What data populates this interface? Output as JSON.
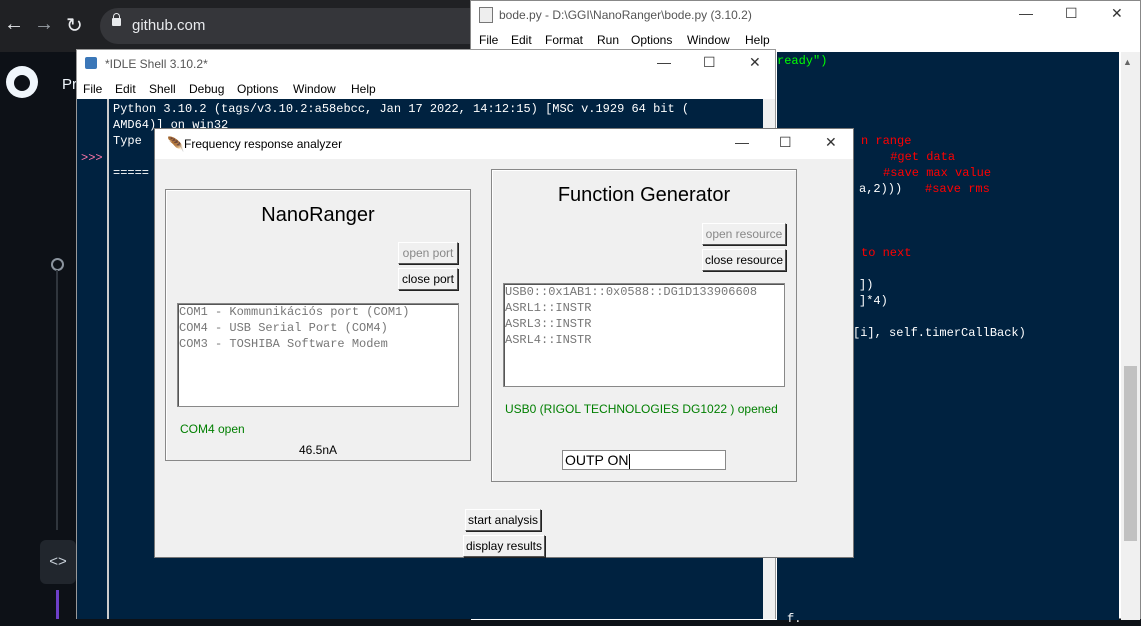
{
  "browser": {
    "url": "github.com",
    "partial_nav_text": "Pr",
    "back_glyph": "←",
    "forward_glyph": "→",
    "reload_glyph": "↻",
    "code_glyph": "<>"
  },
  "editor": {
    "title": "bode.py - D:\\GGI\\NanoRanger\\bode.py (3.10.2)",
    "menu": [
      "File",
      "Edit",
      "Format",
      "Run",
      "Options",
      "Window",
      "Help"
    ],
    "code_lines": [
      {
        "text": "ready\")",
        "color": "#00ff00"
      },
      {
        "text": "n range",
        "color": "#ff0000"
      },
      {
        "text": "      #get data",
        "color": "#ff0000"
      },
      {
        "text": "     #save max value",
        "color": "#ff0000"
      },
      {
        "text": "a,2)))",
        "color": "#ffffff"
      },
      {
        "text": "#save rms",
        "color": "#ff0000"
      },
      {
        "text": "to next",
        "color": "#ff0000"
      },
      {
        "text": "])",
        "color": "#ffffff"
      },
      {
        "text": "]*4)",
        "color": "#ffffff"
      },
      {
        "text": "[i], self.timerCallBack)",
        "color": "#ffffff"
      },
      {
        "text": "f.",
        "color": "#ffffff"
      }
    ]
  },
  "idle": {
    "title": "*IDLE Shell 3.10.2*",
    "menu": [
      "File",
      "Edit",
      "Shell",
      "Debug",
      "Options",
      "Window",
      "Help"
    ],
    "line1": "Python 3.10.2 (tags/v3.10.2:a58ebcc, Jan 17 2022, 14:12:15) [MSC v.1929 64 bit (",
    "line2": "AMD64)] on win32",
    "line3": "Type",
    "prompt": ">>>",
    "separator": "====="
  },
  "dialog": {
    "title": "Frequency response analyzer",
    "nanoranger": {
      "heading": "NanoRanger",
      "open_port": "open port",
      "close_port": "close port",
      "ports": [
        "COM1 - Kommunikációs port (COM1)",
        "COM4 - USB Serial Port (COM4)",
        "COM3 - TOSHIBA Software Modem"
      ],
      "status": "COM4 open",
      "reading": "46.5nA"
    },
    "function_generator": {
      "heading": "Function Generator",
      "open_resource": "open resource",
      "close_resource": "close resource",
      "resources": [
        "USB0::0x1AB1::0x0588::DG1D133906608",
        "ASRL1::INSTR",
        "ASRL3::INSTR",
        "ASRL4::INSTR"
      ],
      "status": "USB0 (RIGOL TECHNOLOGIES DG1022 ) opened",
      "command_value": "OUTP ON"
    },
    "start_analysis": "start analysis",
    "display_results": "display results"
  },
  "window_controls": {
    "minimize": "—",
    "maximize": "☐",
    "close": "✕"
  },
  "colors": {
    "editor_bg": "#002240",
    "status_green": "#007f00",
    "github_bg": "#0d1117"
  }
}
